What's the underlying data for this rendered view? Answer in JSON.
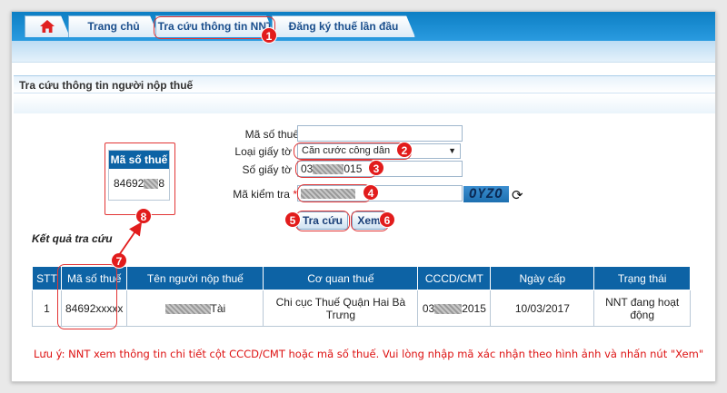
{
  "nav": {
    "home_icon": "home-icon",
    "tabs": [
      "Trang chủ",
      "Tra cứu thông tin NNT",
      "Đăng ký thuế lần đầu"
    ]
  },
  "section": {
    "title": "Tra cứu thông tin người nộp thuế"
  },
  "form": {
    "mst_label": "Mã số thuế",
    "mst_value": "",
    "doc_type_label": "Loại giấy tờ",
    "doc_type_value": "Căn cước công dân",
    "doc_no_label": "Số giấy tờ",
    "doc_no_prefix": "03",
    "doc_no_suffix": "015",
    "captcha_label": "Mã kiểm tra",
    "captcha_required": "*",
    "captcha_text": "OYZO",
    "search_button": "Tra cứu",
    "view_button": "Xem"
  },
  "mini_card": {
    "header": "Mã số thuế",
    "value_prefix": "84692",
    "value_suffix": "8"
  },
  "results": {
    "title": "Kết quả tra cứu",
    "columns": [
      "STT",
      "Mã số thuế",
      "Tên người nộp thuế",
      "Cơ quan thuế",
      "CCCD/CMT",
      "Ngày cấp",
      "Trạng thái"
    ],
    "row": {
      "stt": "1",
      "mst": "84692xxxxx",
      "name_suffix": "Tài",
      "agency": "Chi cục Thuế Quận Hai Bà Trưng",
      "cccd_prefix": "03",
      "cccd_suffix": "2015",
      "issue_date": "10/03/2017",
      "status": "NNT đang hoạt động"
    }
  },
  "note": "Lưu ý: NNT xem thông tin chi tiết cột CCCD/CMT hoặc mã số thuế. Vui lòng nhập mã xác nhận theo hình ảnh và nhấn nút \"Xem\"",
  "badges": [
    "1",
    "2",
    "3",
    "4",
    "5",
    "6",
    "7",
    "8"
  ],
  "colors": {
    "header_blue": "#0d63a5",
    "annotation_red": "#e21c1c",
    "note_red": "#d11111"
  }
}
